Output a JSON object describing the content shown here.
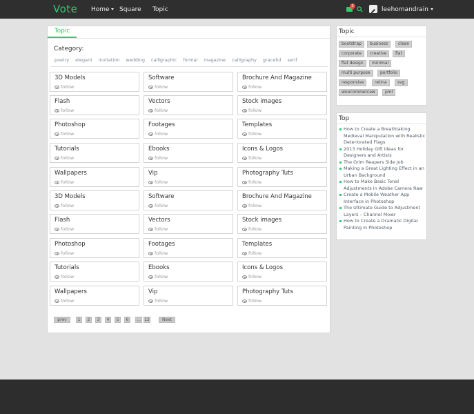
{
  "header": {
    "logo": "Vote",
    "nav": [
      {
        "label": "Home",
        "has_caret": true
      },
      {
        "label": "Square",
        "has_caret": false
      },
      {
        "label": "Topic",
        "has_caret": false
      }
    ],
    "message_badge": "3",
    "user_name": "leehomandrain",
    "accent_color": "#2ecc71"
  },
  "main": {
    "tab": "Topic",
    "category_label": "Category:",
    "category_tags": [
      "poetry",
      "elegant",
      "invitation",
      "wedding",
      "calligraphic",
      "formal",
      "magazine",
      "calligraphy",
      "graceful",
      "serif"
    ],
    "follow_label": "follow",
    "cards": [
      [
        "3D Models",
        "Software",
        "Brochure And Magazine"
      ],
      [
        "Flash",
        "Vectors",
        "Stock images"
      ],
      [
        "Photoshop",
        "Footages",
        "Templates"
      ],
      [
        "Tutorials",
        "Ebooks",
        "Icons & Logos"
      ],
      [
        "Wallpapers",
        "Vip",
        "Photography Tuts"
      ],
      [
        "3D Models",
        "Software",
        "Brochure And Magazine"
      ],
      [
        "Flash",
        "Vectors",
        "Stock images"
      ],
      [
        "Photoshop",
        "Footages",
        "Templates"
      ],
      [
        "Tutorials",
        "Ebooks",
        "Icons & Logos"
      ],
      [
        "Wallpapers",
        "Vip",
        "Photography Tuts"
      ]
    ],
    "pagination": {
      "prev": "prev",
      "pages": [
        "1",
        "2",
        "3",
        "4",
        "5",
        "6",
        "...",
        "12"
      ],
      "next": "Next"
    }
  },
  "sidebar": {
    "topic_title": "Topic",
    "topic_tags": [
      [
        "bootstrap",
        "business",
        "clean"
      ],
      [
        "corporate",
        "creative",
        "flat"
      ],
      [
        "flat design",
        "minimal"
      ],
      [
        "multi purpose",
        "portfolio"
      ],
      [
        "responsive",
        "retina",
        "svg"
      ],
      [
        "woocommercew",
        "pml"
      ]
    ],
    "top_title": "Top",
    "top_items": [
      "How to Create a Breathtaking Medieval Manipulation with Realistic Deteriorated Flags",
      "2013 Holiday Gift Ideas for Designers and Artists",
      "The Grim Reapers Side Job",
      "Making a Great Lighting Effect in an Urban Background",
      "How to Make Basic Tonal Adjustments in Adobe Camera Raw",
      "Create a Mobile Weather App Interface in Photoshop",
      "The Ultimate Guide to Adjustment Layers – Channel Mixer",
      "How to Create a Dramatic Digital Painting in Photoshop"
    ]
  }
}
